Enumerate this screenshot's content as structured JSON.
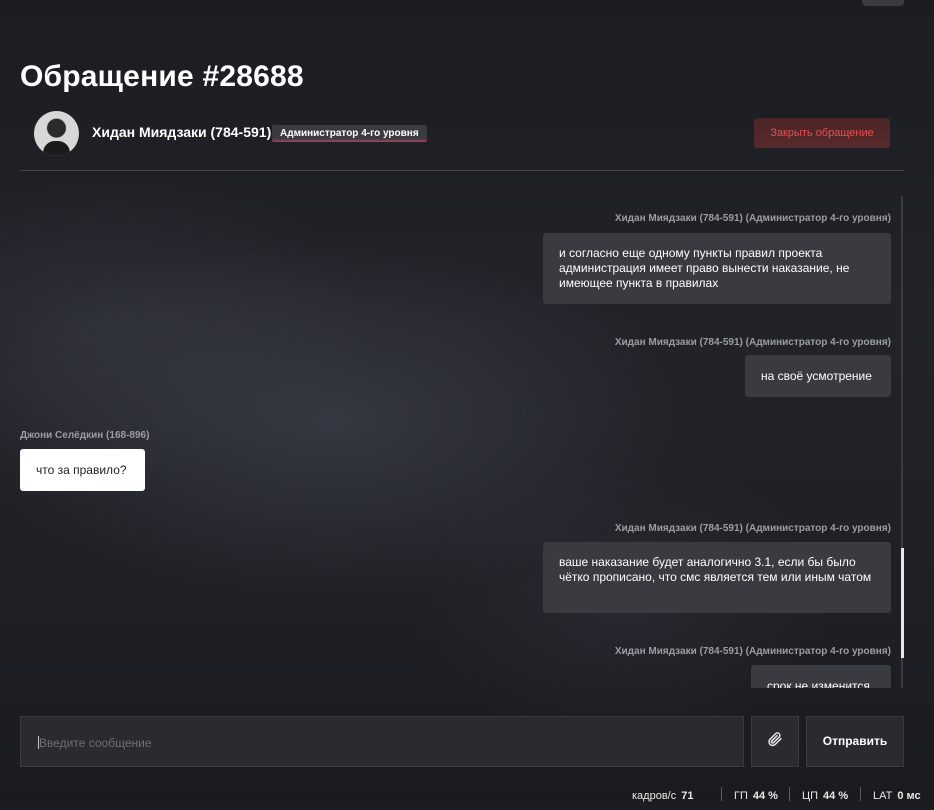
{
  "header": {
    "title": "Обращение #28688",
    "user_name": "Хидан Миядзаки (784-591)",
    "role": "Администратор 4-го уровня",
    "close_label": "Закрыть обращение"
  },
  "messages": [
    {
      "author": "Хидан Миядзаки (784-591) (Администратор 4-го уровня)",
      "text": "и согласно еще одному пункты правил проекта администрация имеет право вынести наказание, не имеющее пункта в правилах",
      "side": "out"
    },
    {
      "author": "Хидан Миядзаки (784-591) (Администратор 4-го уровня)",
      "text": "на своё усмотрение",
      "side": "out"
    },
    {
      "author": "Джони Селёдкин (168-896)",
      "text": "что за правило?",
      "side": "in"
    },
    {
      "author": "Хидан Миядзаки (784-591) (Администратор 4-го уровня)",
      "text": "ваше наказание будет аналогично 3.1, если бы было чётко прописано, что смс является тем или иным чатом",
      "side": "out"
    },
    {
      "author": "Хидан Миядзаки (784-591) (Администратор 4-го уровня)",
      "text": "срок не изменится",
      "side": "out"
    }
  ],
  "composer": {
    "placeholder": "Введите сообщение",
    "send_label": "Отправить",
    "attach_icon": "paperclip-icon"
  },
  "stats": {
    "fps_label": "кадров/с",
    "fps_value": "71",
    "gpu_label": "ГП",
    "gpu_value": "44 %",
    "cpu_label": "ЦП",
    "cpu_value": "44 %",
    "lat_label": "LAT",
    "lat_value": "0 мс"
  },
  "colors": {
    "close_text": "#e25050",
    "badge_accent": "#c0395e",
    "bubble_out": "#3a3b41",
    "bubble_in": "#ffffff"
  }
}
